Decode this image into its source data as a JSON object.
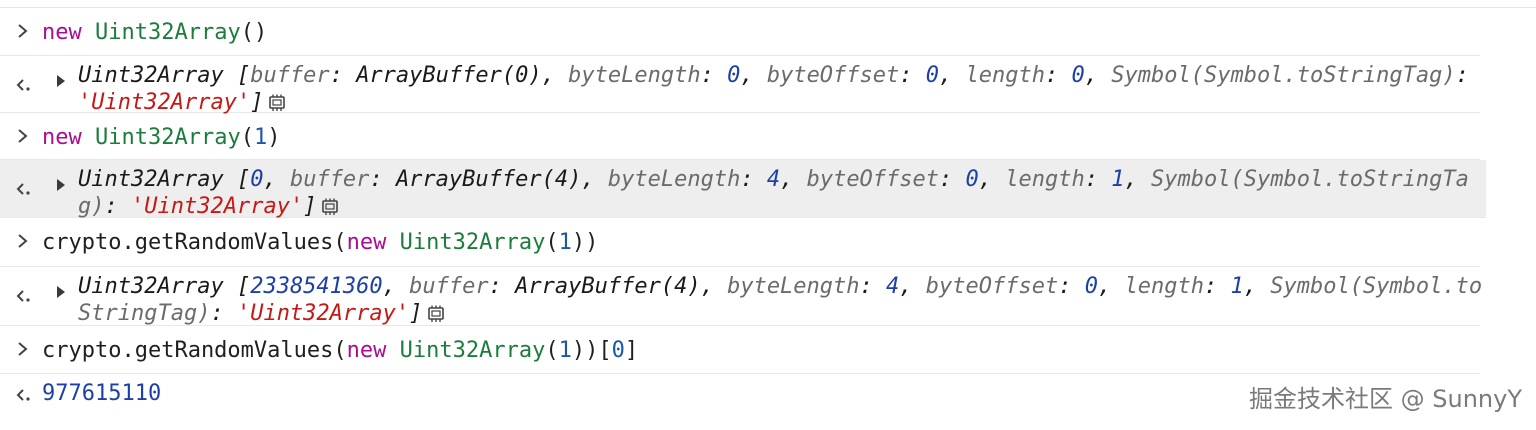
{
  "entries": [
    {
      "input": {
        "kw": "new",
        "cls": "Uint32Array",
        "args_open": "(",
        "args_close": ")"
      },
      "result": {
        "type_name": "Uint32Array",
        "open": " [",
        "buffer_key": "buffer",
        "buffer_val": "ArrayBuffer(0)",
        "byteLength_key": "byteLength",
        "byteLength_val": "0",
        "byteOffset_key": "byteOffset",
        "byteOffset_val": "0",
        "length_key": "length",
        "length_val": "0",
        "symbol_key": "Symbol(Symbol.toStringTag)",
        "symbol_val": "'Uint32Array'",
        "close": "]"
      }
    },
    {
      "input": {
        "kw": "new",
        "cls": "Uint32Array",
        "args_open": "(",
        "arg": "1",
        "args_close": ")"
      },
      "result": {
        "type_name": "Uint32Array",
        "open": " [",
        "element0": "0",
        "buffer_key": "buffer",
        "buffer_val": "ArrayBuffer(4)",
        "byteLength_key": "byteLength",
        "byteLength_val": "4",
        "byteOffset_key": "byteOffset",
        "byteOffset_val": "0",
        "length_key": "length",
        "length_val": "1",
        "symbol_key": "Symbol(Symbol.toStringTag)",
        "symbol_val": "'Uint32Array'",
        "close": "]"
      }
    },
    {
      "input": {
        "prefix": "crypto.getRandomValues(",
        "kw": "new",
        "cls": "Uint32Array",
        "args_open": "(",
        "arg": "1",
        "args_close": "))"
      },
      "result": {
        "type_name": "Uint32Array",
        "open": " [",
        "element0": "2338541360",
        "buffer_key": "buffer",
        "buffer_val": "ArrayBuffer(4)",
        "byteLength_key": "byteLength",
        "byteLength_val": "4",
        "byteOffset_key": "byteOffset",
        "byteOffset_val": "0",
        "length_key": "length",
        "length_val": "1",
        "symbol_key": "Symbol(Symbol.toStringTag)",
        "symbol_val": "'Uint32Array'",
        "close": "]"
      }
    },
    {
      "input": {
        "prefix": "crypto.getRandomValues(",
        "kw": "new",
        "cls": "Uint32Array",
        "args_open": "(",
        "arg": "1",
        "args_close": "))[",
        "index": "0",
        "index_close": "]"
      },
      "result": {
        "value": "977615110"
      }
    }
  ],
  "watermark": "掘金技术社区 @ SunnyY",
  "colors": {
    "keyword": "#aa0d91",
    "class": "#1c7c3c",
    "number": "#1c3fa8",
    "string": "#c41a16",
    "property_key": "#6b6b6b",
    "highlight_row": "#eeeeee"
  },
  "icons": {
    "prompt": "chevron-right-icon",
    "result": "return-arrow-icon",
    "expand": "triangle-right-icon",
    "memory": "memory-inspector-icon"
  }
}
